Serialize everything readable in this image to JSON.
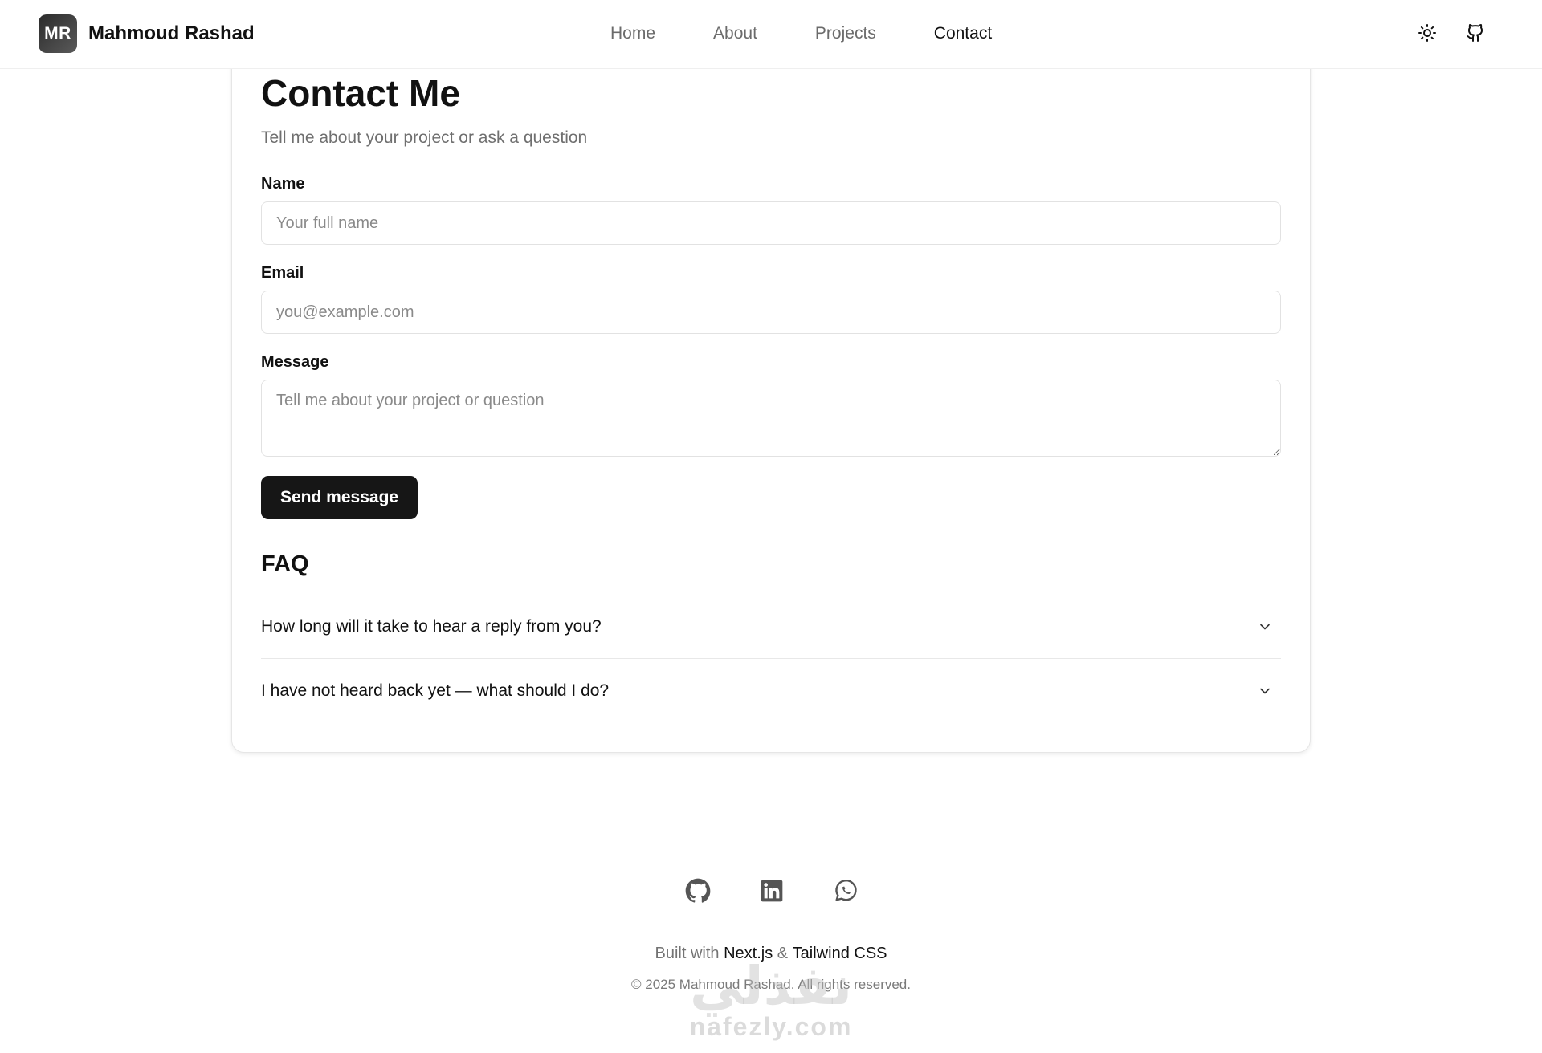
{
  "header": {
    "logo_initials": "MR",
    "brand_name": "Mahmoud Rashad",
    "nav": [
      {
        "label": "Home"
      },
      {
        "label": "About"
      },
      {
        "label": "Projects"
      },
      {
        "label": "Contact",
        "active": true
      }
    ],
    "icons": [
      "sun-icon",
      "github-icon"
    ]
  },
  "contact": {
    "title": "Contact Me",
    "subtitle": "Tell me about your project or ask a question",
    "form": {
      "name_label": "Name",
      "name_placeholder": "Your full name",
      "email_label": "Email",
      "email_placeholder": "you@example.com",
      "message_label": "Message",
      "message_placeholder": "Tell me about your project or question",
      "submit_label": "Send message"
    },
    "faq": {
      "title": "FAQ",
      "items": [
        {
          "question": "How long will it take to hear a reply from you?"
        },
        {
          "question": "I have not heard back yet — what should I do?"
        }
      ]
    }
  },
  "footer": {
    "social_icons": [
      "github-icon",
      "linkedin-icon",
      "whatsapp-icon"
    ],
    "built_prefix": "Built with",
    "built_tech1": "Next.js",
    "built_amp": "&",
    "built_tech2": "Tailwind CSS",
    "copyright": "© 2025 Mahmoud Rashad. All rights reserved."
  },
  "watermark": {
    "arabic": "نفذلي",
    "domain": "nafezly.com"
  },
  "colors": {
    "primary_button": "#161616",
    "muted_text": "#6f6f6f",
    "border": "#e2e2e2"
  }
}
